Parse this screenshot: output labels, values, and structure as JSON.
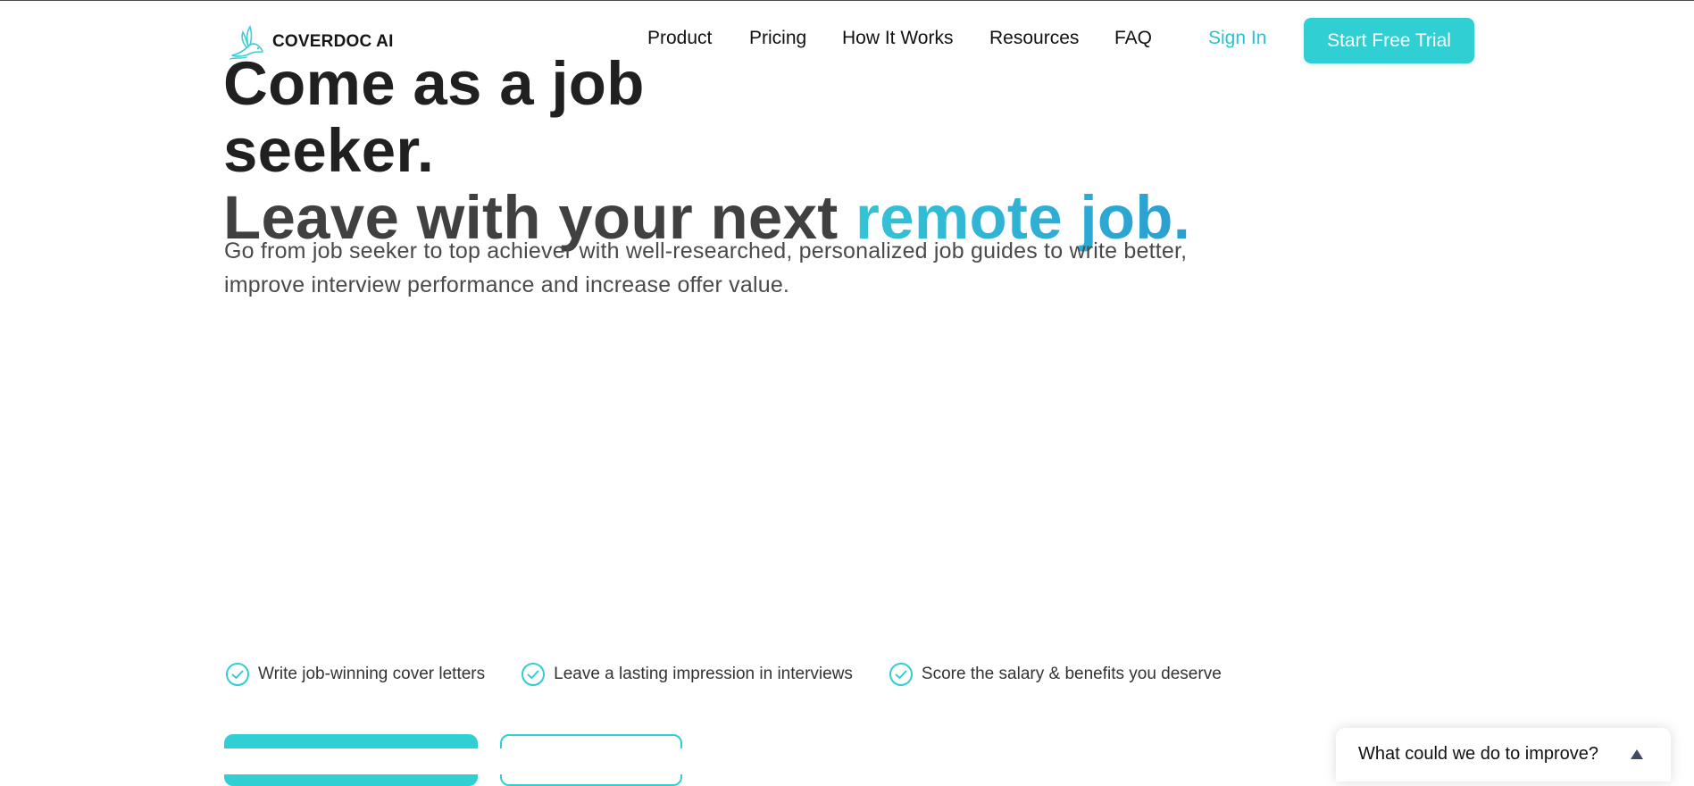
{
  "brand": {
    "name": "COVERDOC AI",
    "logo_icon": "rabbit-logo-icon",
    "accent_color": "#2fcfd3"
  },
  "nav": {
    "links": [
      "Product",
      "Pricing",
      "How It Works",
      "Resources",
      "FAQ"
    ],
    "sign_in": "Sign In",
    "cta": "Start Free Trial"
  },
  "hero": {
    "headline_line1": "Come as a job",
    "headline_line2": "seeker.",
    "headline_line3_prefix": "Leave with your next ",
    "headline_line3_accent": "remote job.",
    "subtitle": "Go from job seeker to top achiever with well-researched, personalized job guides to write better, improve interview performance and increase offer value."
  },
  "features": [
    {
      "label": "Write job-winning cover letters",
      "icon": "check-circle-icon"
    },
    {
      "label": "Leave a lasting impression in interviews",
      "icon": "check-circle-icon"
    },
    {
      "label": "Score the salary & benefits you deserve",
      "icon": "check-circle-icon"
    }
  ],
  "feedback": {
    "prompt": "What could we do to improve?",
    "icon": "chevron-up-icon"
  }
}
